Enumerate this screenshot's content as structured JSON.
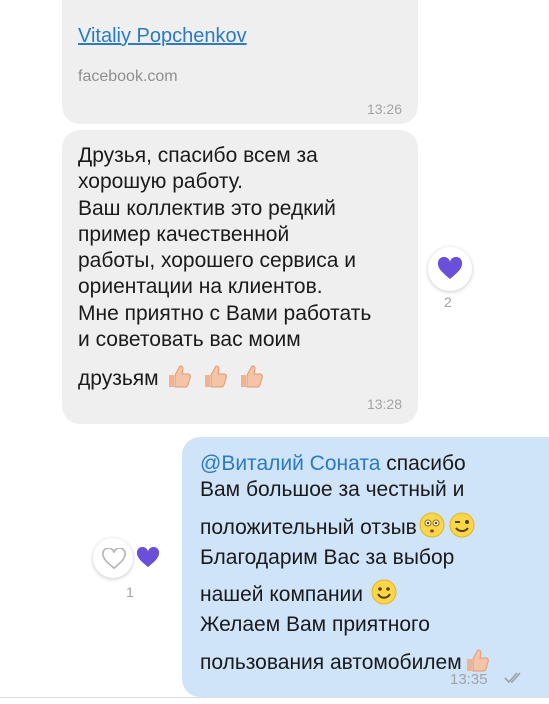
{
  "messages": [
    {
      "link_title": "Vitaliy Popchenkov",
      "link_domain": "facebook.com",
      "time": "13:26"
    },
    {
      "lines": [
        "Друзья, спасибо всем за",
        "хорошую работу.",
        "Ваш коллектив это редкий",
        "пример качественной",
        "работы, хорошего сервиса и",
        "ориентации на клиентов.",
        "Мне приятно с Вами работать",
        "и советовать вас моим",
        "друзьям"
      ],
      "time": "13:28",
      "reaction_count": "2"
    },
    {
      "mention": "@Виталий Соната",
      "lines": [
        " спасибо",
        "Вам большое за честный и",
        "положительный отзыв",
        "Благодарим  Вас за выбор",
        "нашей компании ",
        "Желаем Вам приятного",
        "пользования автомобилем"
      ],
      "time": "13:35",
      "reaction_count": "1"
    }
  ],
  "colors": {
    "incoming_bubble": "#efefef",
    "outgoing_bubble": "#cfe3f9",
    "link": "#2a7ac4",
    "reaction_heart": "#6a4fd8",
    "timestamp": "#a3a3a3"
  },
  "icons": {
    "thumbs_up": "thumbs-up-icon",
    "heart": "heart-icon",
    "heart_outline": "heart-outline-icon",
    "smile": "smile-icon",
    "wink": "wink-icon",
    "blush": "blush-icon",
    "read": "double-check-icon"
  }
}
